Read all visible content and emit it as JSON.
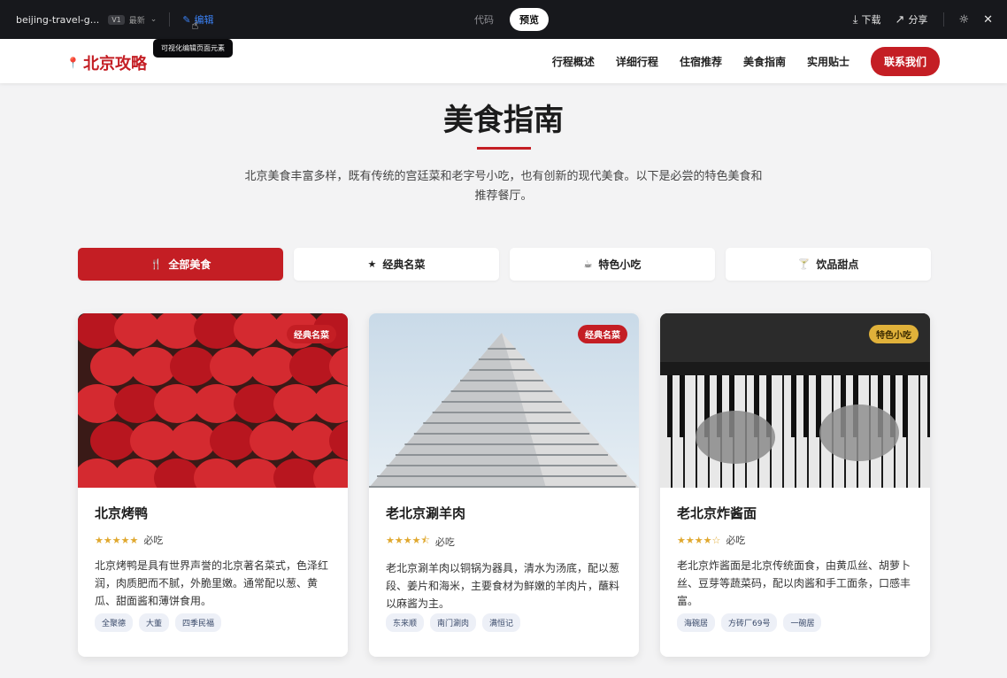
{
  "editor": {
    "file_name": "beijing-travel-g...",
    "version": "V1",
    "version_status": "最新",
    "edit_label": "编辑",
    "tooltip": "可视化编辑页面元素",
    "view_code": "代码",
    "view_preview": "预览",
    "download": "下载",
    "share": "分享"
  },
  "site": {
    "brand": "北京攻略",
    "nav": [
      "行程概述",
      "详细行程",
      "住宿推荐",
      "美食指南",
      "实用贴士"
    ],
    "contact": "联系我们"
  },
  "section": {
    "title": "美食指南",
    "description": "北京美食丰富多样，既有传统的宫廷菜和老字号小吃，也有创新的现代美食。以下是必尝的特色美食和推荐餐厅。"
  },
  "tabs": [
    {
      "label": "全部美食",
      "icon": "utensils-icon",
      "active": true
    },
    {
      "label": "经典名菜",
      "icon": "star-icon",
      "active": false
    },
    {
      "label": "特色小吃",
      "icon": "bowl-icon",
      "active": false
    },
    {
      "label": "饮品甜点",
      "icon": "cocktail-icon",
      "active": false
    }
  ],
  "cards": [
    {
      "badge": "经典名菜",
      "title": "北京烤鸭",
      "stars": "★★★★★",
      "rating_label": "必吃",
      "description": "北京烤鸭是具有世界声誉的北京著名菜式，色泽红润，肉质肥而不腻，外脆里嫩。通常配以葱、黄瓜、甜面酱和薄饼食用。",
      "tags": [
        "全聚德",
        "大董",
        "四季民福"
      ]
    },
    {
      "badge": "经典名菜",
      "title": "老北京涮羊肉",
      "stars": "★★★★⯪",
      "rating_label": "必吃",
      "description": "老北京涮羊肉以铜锅为器具，清水为汤底，配以葱段、姜片和海米，主要食材为鲜嫩的羊肉片，蘸料以麻酱为主。",
      "tags": [
        "东来顺",
        "南门涮肉",
        "满恒记"
      ]
    },
    {
      "badge": "特色小吃",
      "title": "老北京炸酱面",
      "stars": "★★★★☆",
      "rating_label": "必吃",
      "description": "老北京炸酱面是北京传统面食，由黄瓜丝、胡萝卜丝、豆芽等蔬菜码，配以肉酱和手工面条，口感丰富。",
      "tags": [
        "海碗居",
        "方砖厂69号",
        "一碗居"
      ]
    }
  ],
  "colors": {
    "accent": "#c41e24",
    "gold_badge": "#e0b13a",
    "star": "#e0a82e"
  }
}
